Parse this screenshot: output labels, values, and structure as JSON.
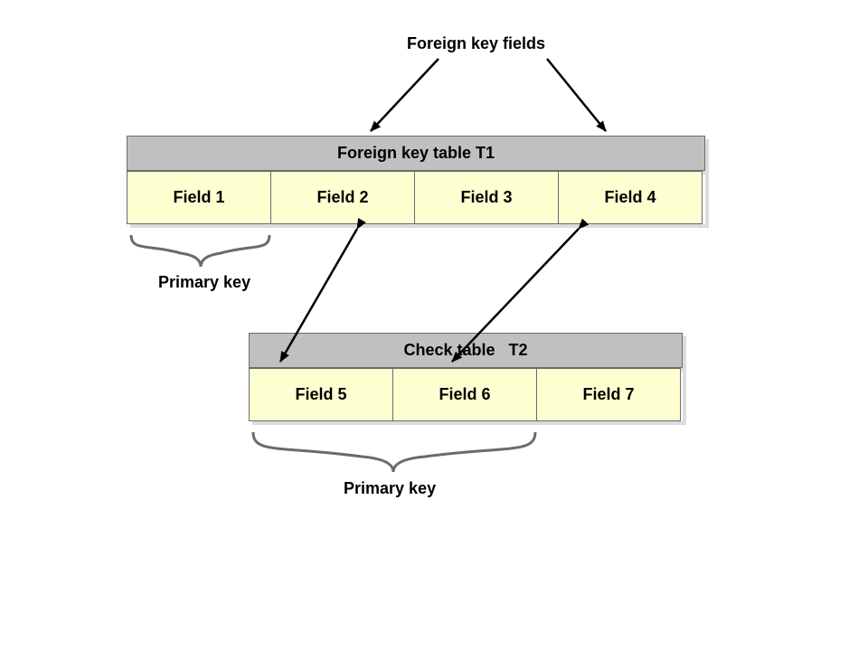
{
  "labels": {
    "top": "Foreign key fields",
    "pk1": "Primary key",
    "pk2": "Primary key"
  },
  "table1": {
    "title": "Foreign key table T1",
    "fields": [
      "Field 1",
      "Field 2",
      "Field 3",
      "Field 4"
    ]
  },
  "table2": {
    "title_a": "Check table",
    "title_b": "T2",
    "fields": [
      "Field 5",
      "Field 6",
      "Field 7"
    ]
  }
}
